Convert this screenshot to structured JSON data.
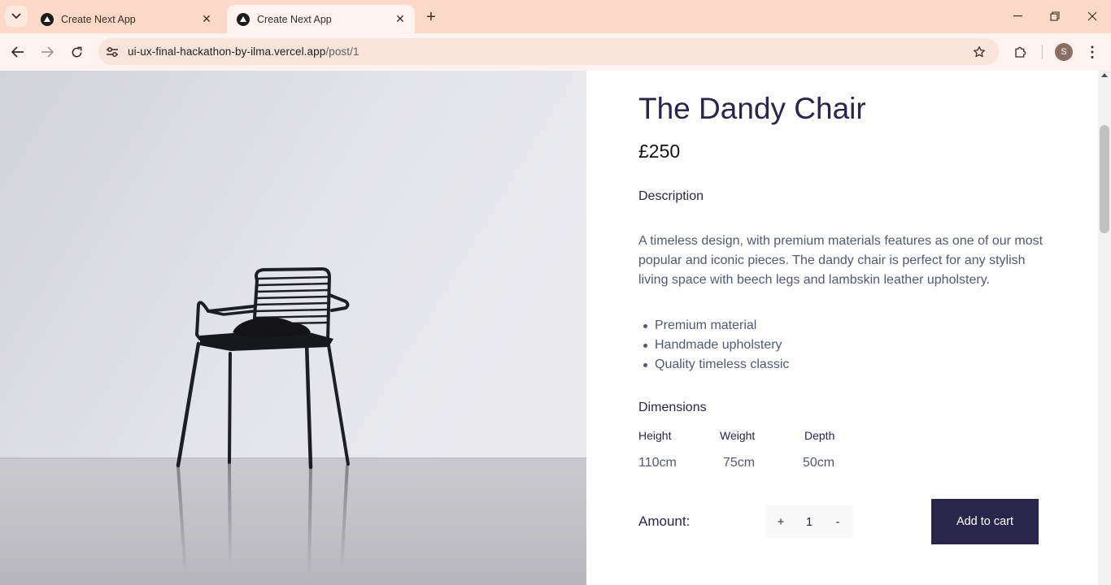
{
  "browser": {
    "tabs": [
      {
        "title": "Create Next App",
        "active": false
      },
      {
        "title": "Create Next App",
        "active": true
      }
    ],
    "url_host": "ui-ux-final-hackathon-by-ilma.vercel.app",
    "url_path": "/post/1",
    "profile_initial": "S"
  },
  "product": {
    "title": "The Dandy Chair",
    "price": "£250",
    "description_label": "Description",
    "description": "A timeless design, with premium materials features as one of our most popular and iconic pieces. The dandy chair is perfect for any stylish living space with beech legs and lambskin leather upholstery.",
    "features": [
      "Premium material",
      "Handmade upholstery",
      "Quality timeless classic"
    ],
    "dimensions_label": "Dimensions",
    "dimensions": [
      {
        "label": "Height",
        "value": "110cm"
      },
      {
        "label": "Weight",
        "value": "75cm"
      },
      {
        "label": "Depth",
        "value": "50cm"
      }
    ],
    "amount_label": "Amount:",
    "plus_label": "+",
    "minus_label": "-",
    "quantity": "1",
    "add_to_cart_label": "Add to cart"
  },
  "colors": {
    "brand_dark": "#2a254b",
    "text_muted": "#505977",
    "chrome_tabbar": "#fcd9c9"
  }
}
